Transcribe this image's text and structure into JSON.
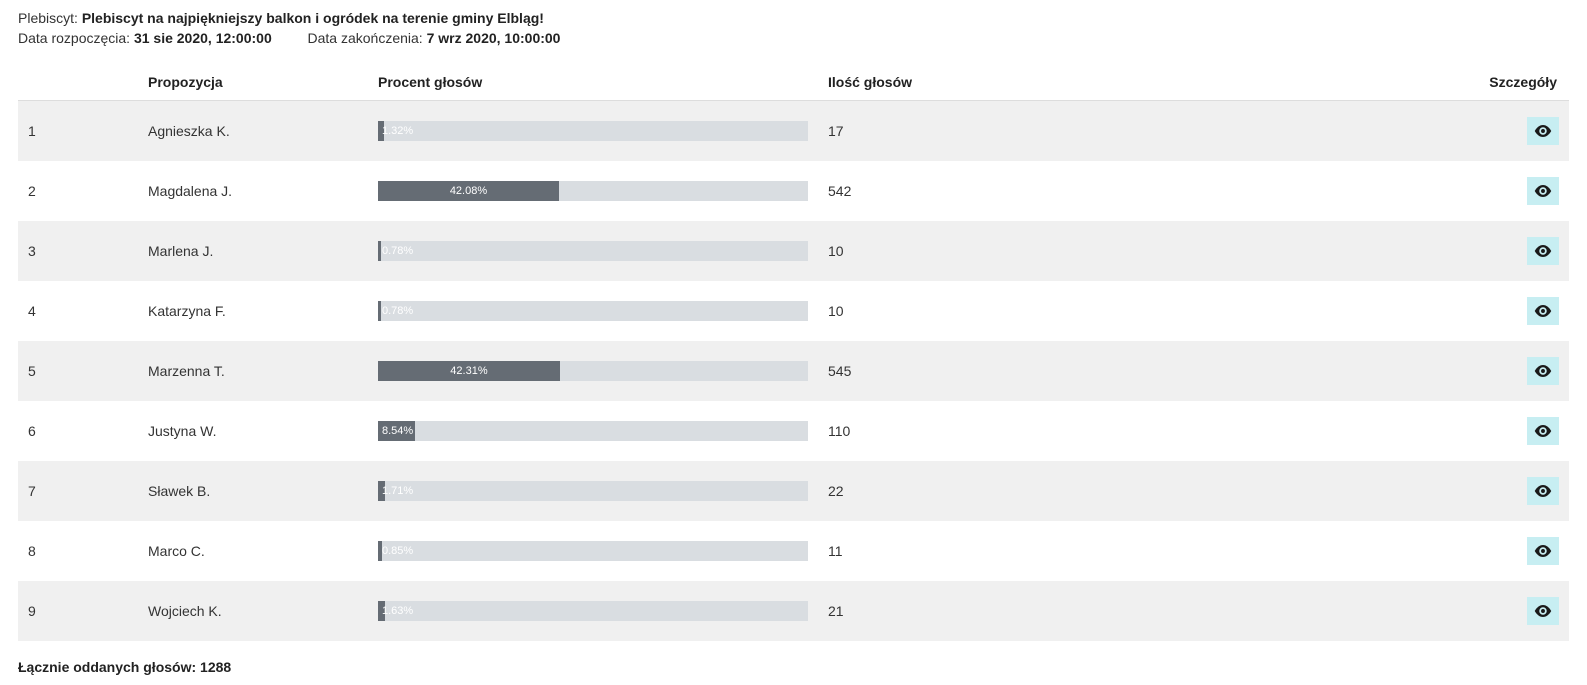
{
  "header": {
    "plebiscyt_label": "Plebiscyt:",
    "plebiscyt_value": "Plebiscyt na najpiękniejszy balkon i ogródek na terenie gminy Elbląg!",
    "start_label": "Data rozpoczęcia:",
    "start_value": "31 sie 2020, 12:00:00",
    "end_label": "Data zakończenia:",
    "end_value": "7 wrz 2020, 10:00:00"
  },
  "columns": {
    "rank": "",
    "name": "Propozycja",
    "percent": "Procent głosów",
    "votes": "Ilość głosów",
    "details": "Szczegóły"
  },
  "rows": [
    {
      "rank": "1",
      "name": "Agnieszka K.",
      "percent_label": "1.32%",
      "percent_value": 1.32,
      "votes": "17"
    },
    {
      "rank": "2",
      "name": "Magdalena J.",
      "percent_label": "42.08%",
      "percent_value": 42.08,
      "votes": "542"
    },
    {
      "rank": "3",
      "name": "Marlena J.",
      "percent_label": "0.78%",
      "percent_value": 0.78,
      "votes": "10"
    },
    {
      "rank": "4",
      "name": "Katarzyna F.",
      "percent_label": "0.78%",
      "percent_value": 0.78,
      "votes": "10"
    },
    {
      "rank": "5",
      "name": "Marzenna T.",
      "percent_label": "42.31%",
      "percent_value": 42.31,
      "votes": "545"
    },
    {
      "rank": "6",
      "name": "Justyna W.",
      "percent_label": "8.54%",
      "percent_value": 8.54,
      "votes": "110"
    },
    {
      "rank": "7",
      "name": "Sławek B.",
      "percent_label": "1.71%",
      "percent_value": 1.71,
      "votes": "22"
    },
    {
      "rank": "8",
      "name": "Marco C.",
      "percent_label": "0.85%",
      "percent_value": 0.85,
      "votes": "11"
    },
    {
      "rank": "9",
      "name": "Wojciech K.",
      "percent_label": "1.63%",
      "percent_value": 1.63,
      "votes": "21"
    }
  ],
  "footer": {
    "total_label": "Łącznie oddanych głosów:",
    "total_value": "1288"
  }
}
